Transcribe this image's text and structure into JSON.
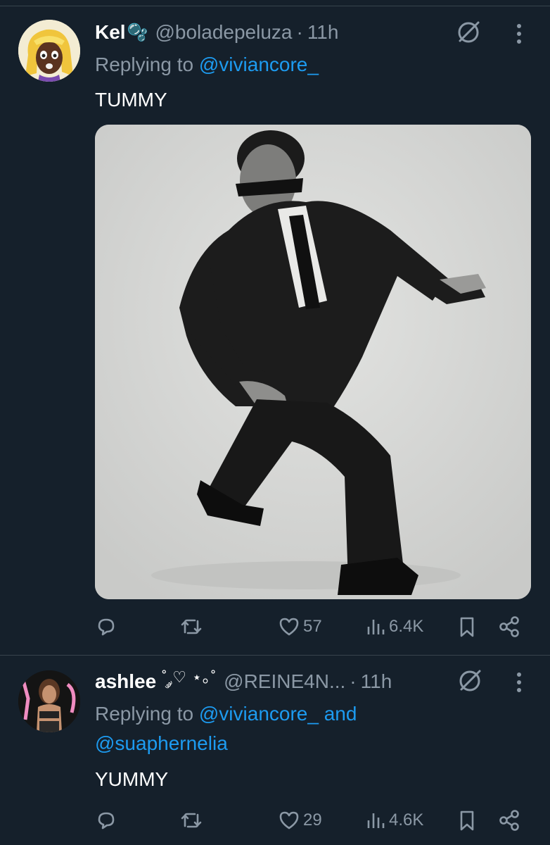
{
  "tweets": [
    {
      "display_name": "Kel",
      "name_emoji": "🫧",
      "handle": "@boladepeluza",
      "time": "11h",
      "replying_prefix": "Replying to",
      "replying_to": "@viviancore_",
      "text": "TUMMY",
      "has_media": true,
      "stats": {
        "replies": "",
        "retweets": "",
        "likes": "57",
        "views": "6.4K"
      }
    },
    {
      "display_name": "ashlee",
      "name_emoji": "˚ ༘♡ ⋆｡˚",
      "handle": "@REINE4N...",
      "time": "11h",
      "replying_prefix": "Replying to",
      "replying_to": "@viviancore_ and",
      "replying_to_2": "@suaphernelia",
      "text": "YUMMY",
      "has_media": false,
      "stats": {
        "replies": "",
        "retweets": "",
        "likes": "29",
        "views": "4.6K"
      }
    }
  ],
  "icons": {
    "more": "more-vertical-icon",
    "grok": "grok-icon",
    "reply": "reply-icon",
    "retweet": "retweet-icon",
    "like": "heart-icon",
    "views": "views-icon",
    "bookmark": "bookmark-icon",
    "share": "share-icon"
  },
  "colors": {
    "background": "#15202b",
    "link": "#1d9bf0",
    "muted": "#8b98a5",
    "divider": "#38444d"
  }
}
